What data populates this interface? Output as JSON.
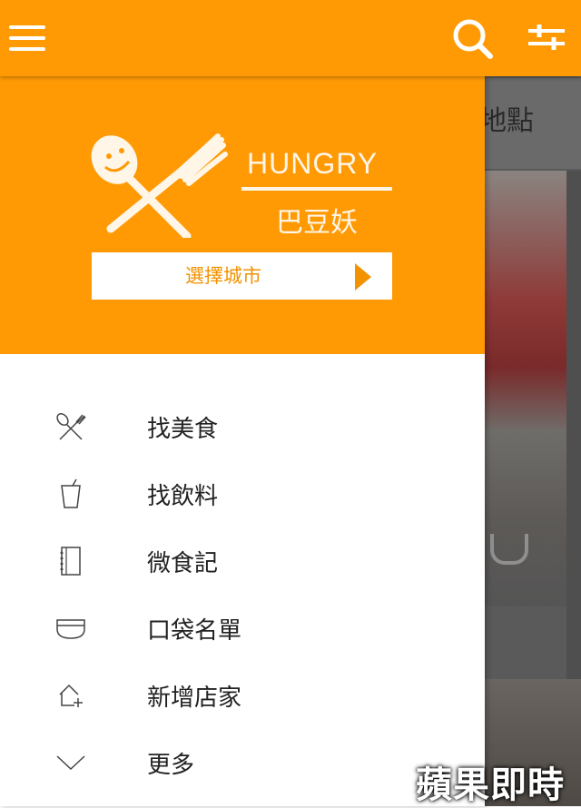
{
  "background": {
    "title_fragment": "地點"
  },
  "appbar": {
    "menu_icon": "hamburger-icon",
    "search_icon": "search-icon",
    "filter_icon": "sliders-icon",
    "color": "#ff9a05"
  },
  "drawer": {
    "header": {
      "brand_en": "HUNGRY",
      "brand_zh": "巴豆妖",
      "city_button_label": "選擇城市"
    },
    "items": [
      {
        "label": "找美食",
        "icon": "fork-spoon-icon"
      },
      {
        "label": "找飲料",
        "icon": "cup-icon"
      },
      {
        "label": "微食記",
        "icon": "notebook-icon"
      },
      {
        "label": "口袋名單",
        "icon": "bowl-icon"
      },
      {
        "label": "新增店家",
        "icon": "add-store-icon"
      },
      {
        "label": "更多",
        "icon": "chevron-down-icon"
      }
    ]
  },
  "watermark": "蘋果即時"
}
